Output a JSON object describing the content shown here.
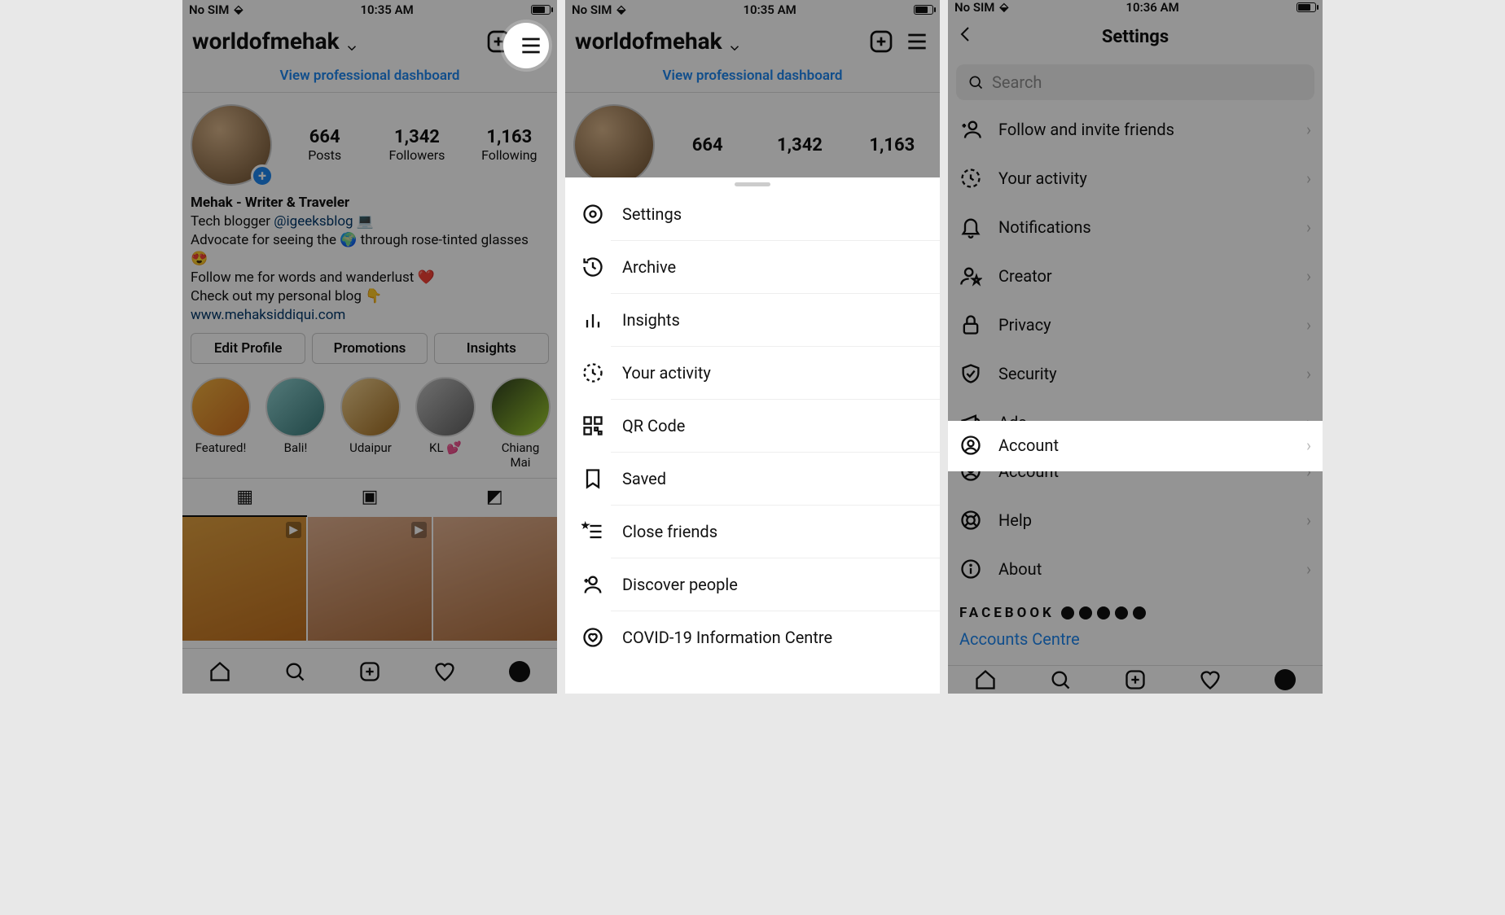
{
  "status": {
    "carrier": "No SIM",
    "time1": "10:35 AM",
    "time2": "10:35 AM",
    "time3": "10:36 AM"
  },
  "profile": {
    "username": "worldofmehak",
    "pro_dashboard": "View professional dashboard",
    "posts": {
      "num": "664",
      "label": "Posts"
    },
    "followers": {
      "num": "1,342",
      "label": "Followers"
    },
    "following": {
      "num": "1,163",
      "label": "Following"
    },
    "display_name": "Mehak - Writer & Traveler",
    "bio_line_pre": "Tech blogger ",
    "bio_handle": "@igeeksblog",
    "bio_laptop": " 💻",
    "bio_line2": "Advocate for seeing the 🌍 through rose-tinted glasses 😍",
    "bio_line3": "Follow me for words and wanderlust ❤️",
    "bio_line4": "Check out my personal blog 👇",
    "bio_url": "www.mehaksiddiqui.com",
    "btn_edit": "Edit Profile",
    "btn_promo": "Promotions",
    "btn_insights": "Insights",
    "highlights": [
      "Featured!",
      "Bali!",
      "Udaipur",
      "KL 💕",
      "Chiang Mai"
    ]
  },
  "menu": {
    "settings": "Settings",
    "archive": "Archive",
    "insights": "Insights",
    "activity": "Your activity",
    "qr": "QR Code",
    "saved": "Saved",
    "close_friends": "Close friends",
    "discover": "Discover people",
    "covid": "COVID-19 Information Centre"
  },
  "settings": {
    "title": "Settings",
    "search_placeholder": "Search",
    "follow_invite": "Follow and invite friends",
    "your_activity": "Your activity",
    "notifications": "Notifications",
    "creator": "Creator",
    "privacy": "Privacy",
    "security": "Security",
    "ads": "Ads",
    "account": "Account",
    "help": "Help",
    "about": "About",
    "facebook": "FACEBOOK",
    "accounts_centre": "Accounts Centre"
  }
}
